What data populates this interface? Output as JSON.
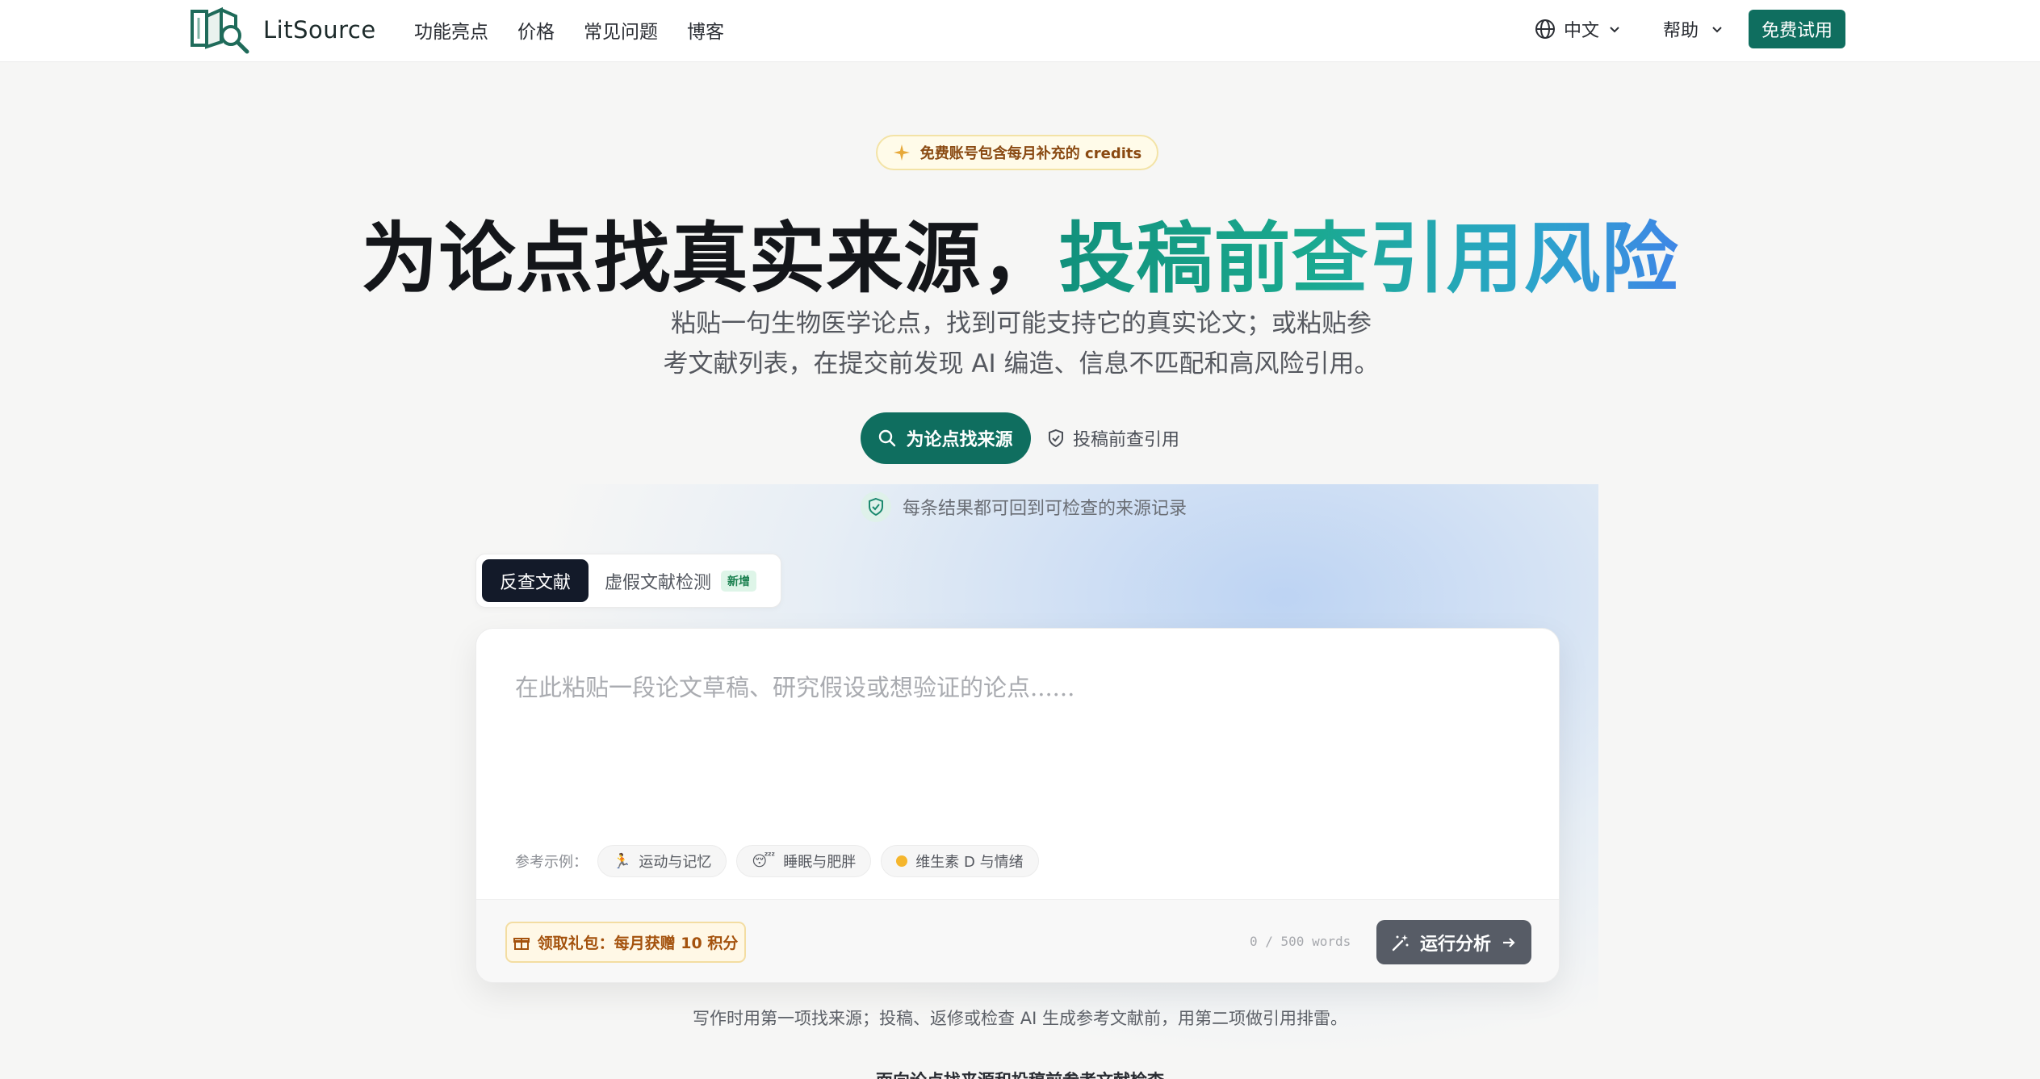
{
  "header": {
    "brand": "LitSource",
    "nav": [
      "功能亮点",
      "价格",
      "常见问题",
      "博客"
    ],
    "language": "中文",
    "help": "帮助",
    "cta": "免费试用"
  },
  "hero": {
    "badge": "免费账号包含每月补充的 credits",
    "headline_dark": "为论点找真实来源，",
    "headline_accent": "投稿前查引用风险",
    "subtitle_line1": "粘贴一句生物医学论点，找到可能支持它的真实论文；或粘贴参",
    "subtitle_line2": "考文献列表，在提交前发现 AI 编造、信息不匹配和高风险引用。",
    "primary_cta": "为论点找来源",
    "secondary_cta": "投稿前查引用",
    "trust_text": "每条结果都可回到可检查的来源记录"
  },
  "tabs": {
    "active": "反查文献",
    "other": "虚假文献检测",
    "new_tag": "新增"
  },
  "editor": {
    "placeholder": "在此粘贴一段论文草稿、研究假设或想验证的论点......",
    "examples_label": "参考示例：",
    "examples": [
      {
        "icon": "runner",
        "label": "运动与记忆"
      },
      {
        "icon": "sleepy-face",
        "label": "睡眠与肥胖"
      },
      {
        "icon": "sun-dot",
        "label": "维生素 D 与情绪"
      }
    ],
    "gift": "领取礼包：每月获赠 10 积分",
    "word_count": "0 / 500 words",
    "run_button": "运行分析"
  },
  "footnote": "写作时用第一项找来源；投稿、返修或检查 AI 生成参考文献前，用第二项做引用排雷。",
  "section_peek": "面向论点找来源和投稿前参考文献检查",
  "colors": {
    "brand": "#0f6e5f",
    "accent_gradient": [
      "#12917c",
      "#3f86e6"
    ],
    "run_button": "#575c66"
  }
}
